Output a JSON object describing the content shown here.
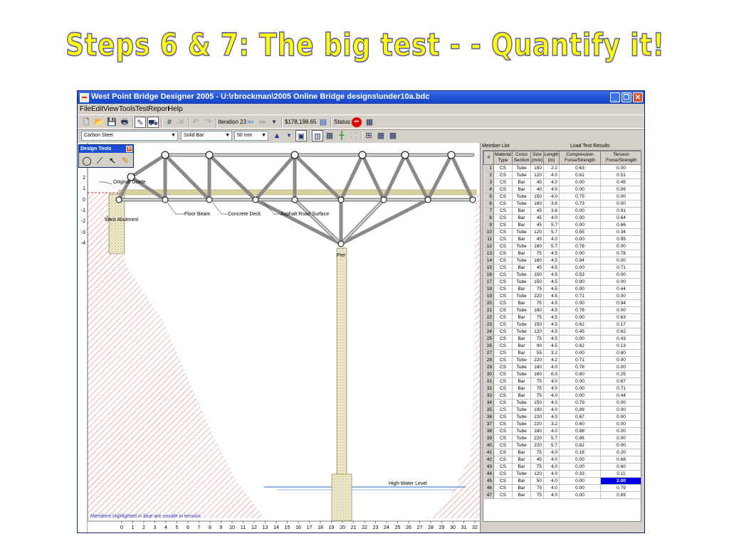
{
  "slide": {
    "title": "Steps 6 & 7: The big test - - Quantify it!"
  },
  "window": {
    "title": "West Point Bridge Designer 2005 - U:\\rbrockman\\2005 Online Bridge designs\\under10a.bdc",
    "menu": [
      "File",
      "Edit",
      "View",
      "Tools",
      "Test",
      "Report",
      "Help"
    ],
    "toolbar": {
      "iteration": "Iteration 23",
      "cost": "$178,198.65",
      "status_label": "Status:",
      "material": "Carbon Steel",
      "section": "Solid Bar",
      "size": "50 mm"
    },
    "icons": {
      "new": "new-file-icon",
      "open": "open-folder-icon",
      "save": "save-disk-icon",
      "print": "printer-icon",
      "load_test": "load-test-icon",
      "drawing_board": "drawing-board-icon",
      "delete": "delete-icon",
      "undo": "undo-icon",
      "redo": "redo-icon",
      "prev": "arrow-left-icon",
      "next": "arrow-right-icon",
      "status": "status-fail-icon",
      "calculator": "calculator-icon",
      "size_up": "increase-size-icon",
      "size_down": "decrease-size-icon"
    },
    "colors": {
      "title_bar": "#1c4ed2",
      "pier_fill": "#e8e0b8",
      "deck": "#d8d0a0",
      "hatch": "#c03030",
      "highlight": "#0000e0",
      "status_fail": "#e00000"
    }
  },
  "design_tools": {
    "title": "Design Tools"
  },
  "canvas": {
    "labels": {
      "original_grade": "Original Grade",
      "west_abutment": "West Abutment",
      "floor_beam": "Floor Beam",
      "concrete_deck": "Concrete Deck",
      "asphalt": "Asphalt Road Surface",
      "pier": "Pier",
      "high_water": "High-Water Level",
      "note": "Members highlighted in blue are unsafe in tension."
    },
    "y_ticks": [
      "2",
      "1",
      "0",
      "-1",
      "-2",
      "-3",
      "-4"
    ],
    "x_ticks": [
      "0",
      "1",
      "2",
      "3",
      "4",
      "5",
      "6",
      "7",
      "8",
      "9",
      "10",
      "11",
      "12",
      "13",
      "14",
      "15",
      "16",
      "17",
      "18",
      "19",
      "20",
      "21",
      "22",
      "23",
      "24",
      "25",
      "26",
      "27",
      "28",
      "29",
      "30",
      "31",
      "32"
    ]
  },
  "member_list": {
    "section_label": "Member List",
    "results_label": "Load Test Results",
    "headers": [
      "#",
      "Material Type",
      "Cross Section",
      "Size (mm)",
      "Length (m)",
      "Compression Force/Strength",
      "Tension Force/Strength"
    ],
    "highlight_row": 45,
    "rows": [
      [
        "1",
        "CS",
        "Tube",
        "180",
        "2.2",
        "0.63",
        "0.00"
      ],
      [
        "2",
        "CS",
        "Tube",
        "120",
        "4.0",
        "0.61",
        "0.51"
      ],
      [
        "3",
        "CS",
        "Bar",
        "45",
        "4.0",
        "0.00",
        "0.45"
      ],
      [
        "4",
        "CS",
        "Bar",
        "40",
        "4.0",
        "0.00",
        "0.99"
      ],
      [
        "5",
        "CS",
        "Tube",
        "150",
        "4.0",
        "0.75",
        "0.00"
      ],
      [
        "6",
        "CS",
        "Tube",
        "180",
        "3.6",
        "0.73",
        "0.00"
      ],
      [
        "7",
        "CS",
        "Bar",
        "45",
        "3.6",
        "0.00",
        "0.91"
      ],
      [
        "8",
        "CS",
        "Bar",
        "45",
        "4.0",
        "0.00",
        "0.64"
      ],
      [
        "9",
        "CS",
        "Bar",
        "45",
        "5.7",
        "0.00",
        "0.66"
      ],
      [
        "10",
        "CS",
        "Tube",
        "120",
        "5.7",
        "0.55",
        "0.34"
      ],
      [
        "11",
        "CS",
        "Bar",
        "45",
        "4.0",
        "0.00",
        "0.95"
      ],
      [
        "12",
        "CS",
        "Tube",
        "180",
        "5.7",
        "0.78",
        "0.00"
      ],
      [
        "13",
        "CS",
        "Bar",
        "75",
        "4.5",
        "0.00",
        "0.78"
      ],
      [
        "14",
        "CS",
        "Tube",
        "180",
        "4.5",
        "0.94",
        "0.00"
      ],
      [
        "15",
        "CS",
        "Bar",
        "45",
        "4.5",
        "0.00",
        "0.71"
      ],
      [
        "16",
        "CS",
        "Tube",
        "150",
        "4.5",
        "0.53",
        "0.00"
      ],
      [
        "17",
        "CS",
        "Tube",
        "150",
        "4.5",
        "0.90",
        "0.00"
      ],
      [
        "18",
        "CS",
        "Bar",
        "75",
        "4.5",
        "0.00",
        "0.44"
      ],
      [
        "19",
        "CS",
        "Tube",
        "220",
        "4.5",
        "0.71",
        "0.00"
      ],
      [
        "20",
        "CS",
        "Bar",
        "75",
        "4.5",
        "0.00",
        "0.94"
      ],
      [
        "21",
        "CS",
        "Tube",
        "180",
        "4.5",
        "0.76",
        "0.00"
      ],
      [
        "22",
        "CS",
        "Bar",
        "75",
        "4.5",
        "0.00",
        "0.63"
      ],
      [
        "23",
        "CS",
        "Tube",
        "150",
        "4.5",
        "0.62",
        "0.17"
      ],
      [
        "24",
        "CS",
        "Tube",
        "120",
        "4.5",
        "0.45",
        "0.62"
      ],
      [
        "25",
        "CS",
        "Bar",
        "75",
        "4.5",
        "0.00",
        "0.43"
      ],
      [
        "26",
        "CS",
        "Bar",
        "90",
        "4.5",
        "0.62",
        "0.13"
      ],
      [
        "27",
        "CS",
        "Bar",
        "55",
        "3.2",
        "0.00",
        "0.80"
      ],
      [
        "28",
        "CS",
        "Tube",
        "220",
        "4.2",
        "0.71",
        "0.00"
      ],
      [
        "29",
        "CS",
        "Tube",
        "180",
        "4.0",
        "0.78",
        "0.00"
      ],
      [
        "30",
        "CS",
        "Tube",
        "180",
        "6.0",
        "0.60",
        "0.25"
      ],
      [
        "31",
        "CS",
        "Bar",
        "75",
        "4.0",
        "0.00",
        "0.67"
      ],
      [
        "32",
        "CS",
        "Bar",
        "75",
        "4.0",
        "0.00",
        "0.71"
      ],
      [
        "33",
        "CS",
        "Bar",
        "75",
        "4.0",
        "0.00",
        "0.44"
      ],
      [
        "34",
        "CS",
        "Tube",
        "150",
        "4.0",
        "0.79",
        "0.00"
      ],
      [
        "35",
        "CS",
        "Tube",
        "190",
        "4.0",
        "0.89",
        "0.00"
      ],
      [
        "36",
        "CS",
        "Tube",
        "220",
        "4.0",
        "0.67",
        "0.00"
      ],
      [
        "37",
        "CS",
        "Tube",
        "220",
        "3.2",
        "0.60",
        "0.00"
      ],
      [
        "38",
        "CS",
        "Tube",
        "180",
        "4.0",
        "0.88",
        "0.00"
      ],
      [
        "39",
        "CS",
        "Tube",
        "220",
        "5.7",
        "0.86",
        "0.00"
      ],
      [
        "40",
        "CS",
        "Tube",
        "220",
        "5.7",
        "0.82",
        "0.00"
      ],
      [
        "41",
        "CS",
        "Bar",
        "75",
        "4.0",
        "0.16",
        "0.20"
      ],
      [
        "42",
        "CS",
        "Bar",
        "45",
        "4.0",
        "0.00",
        "0.68"
      ],
      [
        "43",
        "CS",
        "Bar",
        "75",
        "4.0",
        "0.00",
        "0.60"
      ],
      [
        "44",
        "CS",
        "Tube",
        "120",
        "4.0",
        "0.33",
        "0.11"
      ],
      [
        "45",
        "CS",
        "Bar",
        "50",
        "4.0",
        "0.00",
        "2.00"
      ],
      [
        "46",
        "CS",
        "Bar",
        "75",
        "4.0",
        "0.00",
        "0.79"
      ],
      [
        "47",
        "CS",
        "Bar",
        "75",
        "4.0",
        "0.00",
        "0.69"
      ]
    ]
  }
}
